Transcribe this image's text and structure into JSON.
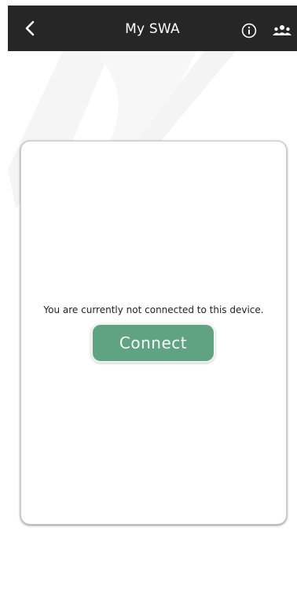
{
  "header": {
    "title": "My SWA",
    "back_icon": "chevron-left-icon",
    "info_icon": "info-icon",
    "group_icon": "group-icon"
  },
  "card": {
    "message": "You are currently not connected to this device.",
    "connect_label": "Connect"
  },
  "colors": {
    "header_bg": "#262626",
    "accent": "#5fa383"
  }
}
